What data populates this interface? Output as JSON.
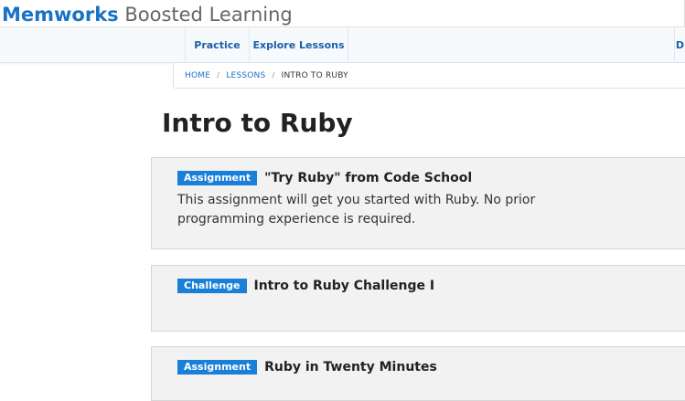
{
  "brand": {
    "primary": "Memworks",
    "secondary": "Boosted Learning"
  },
  "nav": {
    "items": [
      {
        "label": "Practice"
      },
      {
        "label": "Explore Lessons"
      }
    ],
    "right_partial": "D"
  },
  "breadcrumb": {
    "home": "HOME",
    "lessons": "LESSONS",
    "current": "INTRO TO RUBY",
    "separator": "/"
  },
  "page": {
    "title": "Intro to Ruby"
  },
  "items": [
    {
      "badge": "Assignment",
      "title": "\"Try Ruby\" from Code School",
      "description": "This assignment will get you started with Ruby. No prior programming experience is required."
    },
    {
      "badge": "Challenge",
      "title": "Intro to Ruby Challenge I",
      "description": ""
    },
    {
      "badge": "Assignment",
      "title": "Ruby in Twenty Minutes",
      "description": ""
    }
  ],
  "colors": {
    "brand_blue": "#1a72c7",
    "badge_blue": "#1a7fd9",
    "card_bg": "#f2f2f2",
    "nav_bg": "#f6fafd"
  }
}
